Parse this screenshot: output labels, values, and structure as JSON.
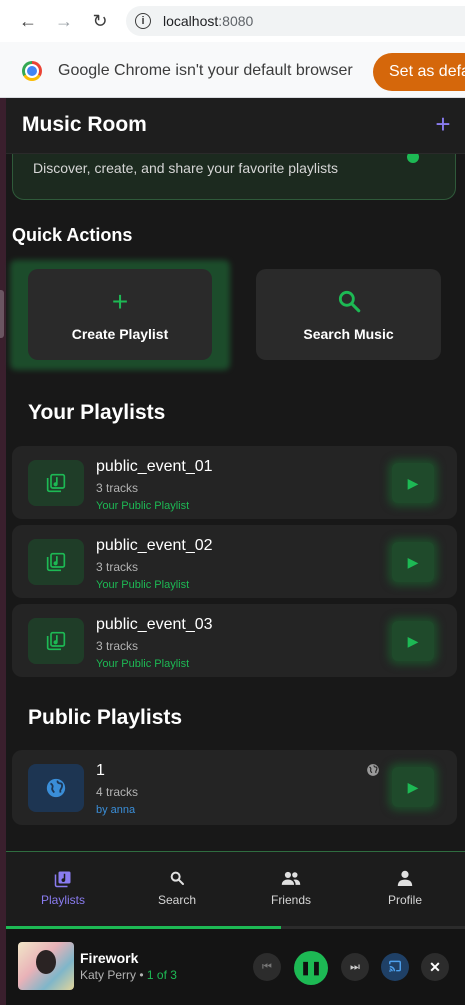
{
  "browser": {
    "url_host": "localhost",
    "url_port": ":8080",
    "infobar_text": "Google Chrome isn't your default browser",
    "default_button": "Set as default"
  },
  "header": {
    "title": "Music Room"
  },
  "hero": {
    "text": "Discover, create, and share your favorite playlists"
  },
  "quick_actions": {
    "title": "Quick Actions",
    "create_label": "Create Playlist",
    "search_label": "Search Music"
  },
  "your_playlists": {
    "title": "Your Playlists",
    "items": [
      {
        "name": "public_event_01",
        "tracks": "3 tracks",
        "owner": "Your Public Playlist"
      },
      {
        "name": "public_event_02",
        "tracks": "3 tracks",
        "owner": "Your Public Playlist"
      },
      {
        "name": "public_event_03",
        "tracks": "3 tracks",
        "owner": "Your Public Playlist"
      }
    ]
  },
  "public_playlists": {
    "title": "Public Playlists",
    "items": [
      {
        "name": "1",
        "tracks": "4 tracks",
        "owner": "by anna"
      }
    ]
  },
  "nav": {
    "items": [
      {
        "label": "Playlists",
        "icon": "playlist-icon"
      },
      {
        "label": "Search",
        "icon": "search-icon"
      },
      {
        "label": "Friends",
        "icon": "friends-icon"
      },
      {
        "label": "Profile",
        "icon": "person-icon"
      }
    ],
    "active": "Playlists"
  },
  "player": {
    "title": "Firework",
    "artist": "Katy Perry",
    "separator": " • ",
    "position": "1 of 3",
    "progress": 0.6
  },
  "colors": {
    "accent": "#1db954",
    "nav_active": "#8a7cf0",
    "owner_public": "#3a8ed8"
  }
}
